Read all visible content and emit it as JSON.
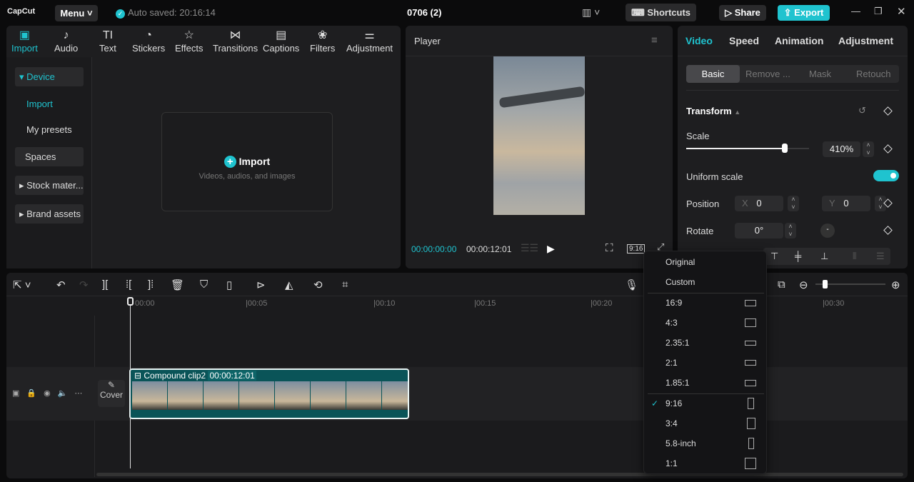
{
  "app": {
    "logo": "CapCut",
    "menu": "Menu",
    "autosave": "Auto saved: 20:16:14",
    "project_title": "0706 (2)",
    "shortcuts": "Shortcuts",
    "share": "Share",
    "export": "Export"
  },
  "media_tabs": [
    {
      "label": "Import",
      "icon": "import-icon"
    },
    {
      "label": "Audio",
      "icon": "audio-icon"
    },
    {
      "label": "Text",
      "icon": "text-icon"
    },
    {
      "label": "Stickers",
      "icon": "sticker-icon"
    },
    {
      "label": "Effects",
      "icon": "effects-icon"
    },
    {
      "label": "Transitions",
      "icon": "transitions-icon"
    },
    {
      "label": "Captions",
      "icon": "captions-icon"
    },
    {
      "label": "Filters",
      "icon": "filters-icon"
    },
    {
      "label": "Adjustment",
      "icon": "adjustment-icon"
    }
  ],
  "sidebar": {
    "items": [
      "Device",
      "Import",
      "My presets",
      "Spaces",
      "Stock mater...",
      "Brand assets"
    ]
  },
  "import_zone": {
    "title": "Import",
    "subtitle": "Videos, audios, and images"
  },
  "player": {
    "title": "Player",
    "current_time": "00:00:00:00",
    "duration": "00:00:12:01",
    "ratio": "9:16"
  },
  "inspector": {
    "tabs": [
      "Video",
      "Speed",
      "Animation",
      "Adjustment"
    ],
    "subtabs": [
      "Basic",
      "Remove ...",
      "Mask",
      "Retouch"
    ],
    "section": "Transform",
    "scale_label": "Scale",
    "scale_value": "410%",
    "scale_fraction": 0.8,
    "uniform_label": "Uniform scale",
    "uniform_on": true,
    "position_label": "Position",
    "x_label": "X",
    "x_value": "0",
    "y_label": "Y",
    "y_value": "0",
    "rotate_label": "Rotate",
    "rotate_value": "0°"
  },
  "timeline": {
    "ticks": [
      "00:00",
      "00:05",
      "00:10",
      "00:15",
      "00:20",
      "00:30"
    ],
    "cover": "Cover",
    "clip_name": "Compound clip2",
    "clip_duration": "00:00:12:01"
  },
  "ratio_menu": {
    "items": [
      "Original",
      "Custom",
      "16:9",
      "4:3",
      "2.35:1",
      "2:1",
      "1.85:1",
      "9:16",
      "3:4",
      "5.8-inch",
      "1:1"
    ],
    "selected": "9:16"
  },
  "colors": {
    "accent": "#1fc3cf",
    "clip": "#0a5458"
  }
}
